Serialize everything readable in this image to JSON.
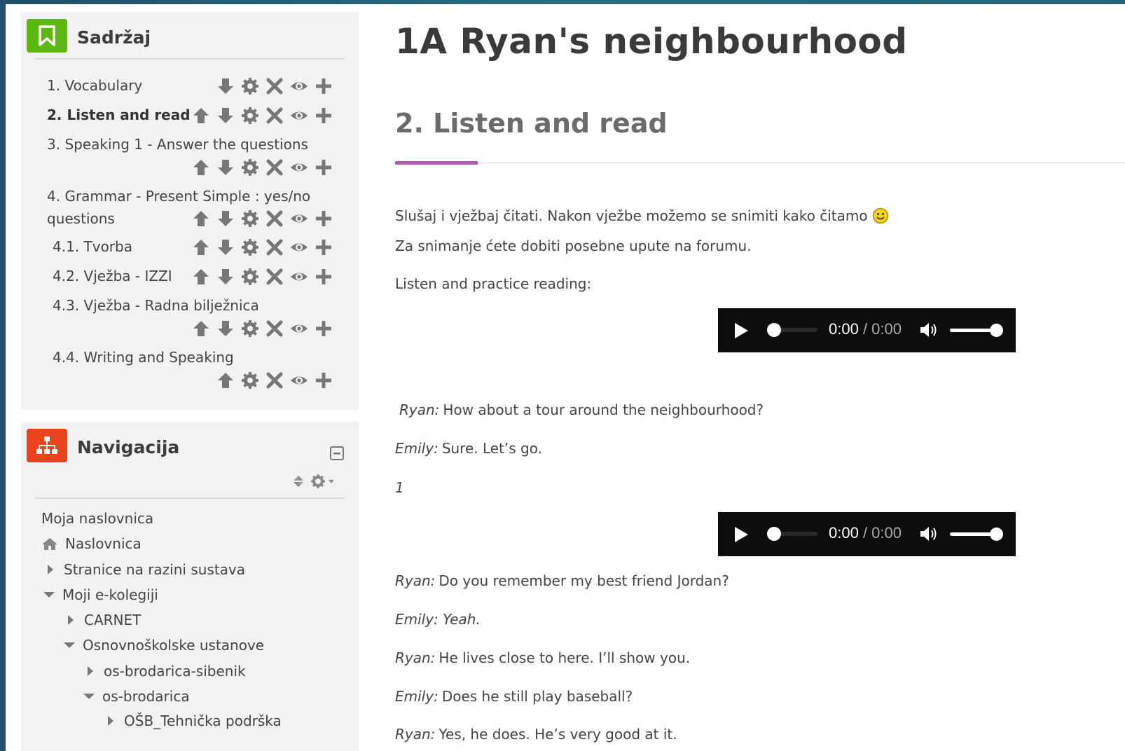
{
  "toc_block": {
    "title": "Sadržaj",
    "items": [
      {
        "label": "1. Vocabulary"
      },
      {
        "label": "2. Listen and read"
      },
      {
        "label": "3. Speaking 1 - Answer the questions"
      },
      {
        "label_line1": "4. Grammar - Present Simple : yes/no",
        "label_line2": "questions"
      },
      {
        "label": "4.1. Tvorba"
      },
      {
        "label": "4.2. Vježba - IZZI"
      },
      {
        "label": "4.3. Vježba - Radna bilježnica"
      },
      {
        "label": "4.4. Writing and Speaking"
      }
    ]
  },
  "nav_block": {
    "title": "Navigacija",
    "items": [
      {
        "label": "Moja naslovnica"
      },
      {
        "label": "Naslovnica"
      },
      {
        "label": "Stranice na razini sustava"
      },
      {
        "label": "Moji e-kolegiji"
      },
      {
        "label": "CARNET"
      },
      {
        "label": "Osnovnoškolske ustanove"
      },
      {
        "label": "os-brodarica-sibenik"
      },
      {
        "label": "os-brodarica"
      },
      {
        "label": "OŠB_Tehnička podrška"
      }
    ]
  },
  "main": {
    "title": "1A Ryan's neighbourhood",
    "section_title": "2. Listen and read",
    "intro1": "Slušaj i vježbaj čitati. Nakon vježbe možemo se snimiti kako čitamo",
    "intro2": "Za snimanje ćete dobiti posebne upute na forumu.",
    "intro3": "Listen and practice reading:",
    "audio_time_current": "0:00",
    "audio_time_sep": " / ",
    "audio_time_total": "0:00",
    "dialogue1": [
      {
        "speaker": "Ryan:",
        "text": "How about a tour around the neighbourhood?"
      },
      {
        "speaker": "Emily:",
        "text": "Sure. Let’s go."
      }
    ],
    "marker": "1",
    "dialogue2": [
      {
        "speaker": "Ryan:",
        "text": "Do you remember my best friend Jordan?"
      },
      {
        "speaker": "Emily: Yeah.",
        "text": ""
      },
      {
        "speaker": "Ryan:",
        "text": "He lives close to here. I’ll show you."
      },
      {
        "speaker": "Emily:",
        "text": "Does he still play baseball?"
      },
      {
        "speaker": "Ryan:",
        "text": "Yes, he does. He’s very good at it."
      }
    ]
  },
  "colors": {
    "accent_purple": "#b05cb0",
    "toc_icon_green": "#5cb811",
    "nav_icon_red": "#e8451e",
    "control_grey": "#777777"
  }
}
